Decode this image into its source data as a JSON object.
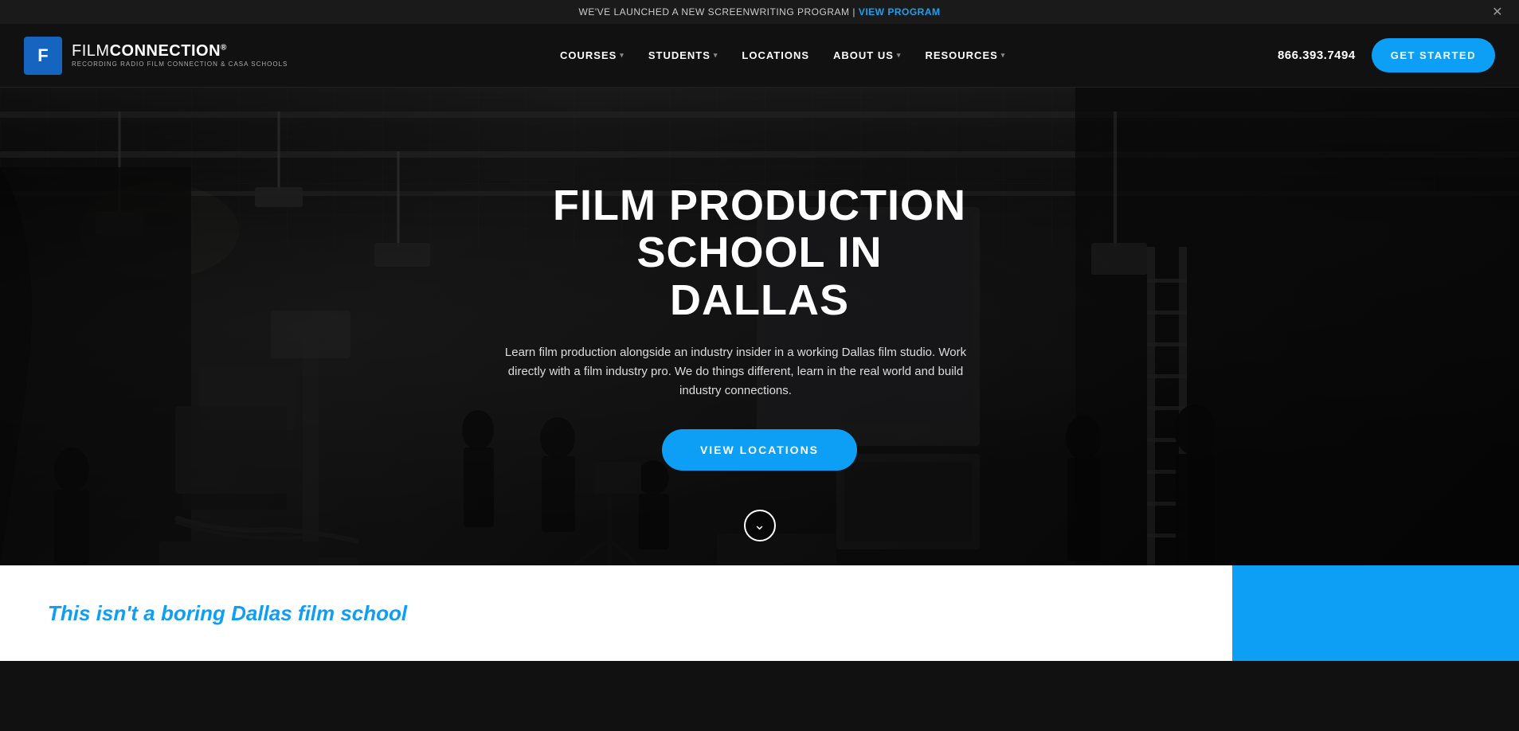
{
  "announcement": {
    "text": "WE'VE LAUNCHED A NEW SCREENWRITING PROGRAM |",
    "link_text": "VIEW PROGRAM",
    "link_href": "#"
  },
  "header": {
    "logo": {
      "icon": "F",
      "name_part1": "FILM",
      "name_part2": "CONNECTION",
      "trademark": "®",
      "subtitle": "RECORDING RADIO FILM CONNECTION & CASA SCHOOLS"
    },
    "nav": [
      {
        "label": "COURSES",
        "has_dropdown": true
      },
      {
        "label": "STUDENTS",
        "has_dropdown": true
      },
      {
        "label": "LOCATIONS",
        "has_dropdown": false
      },
      {
        "label": "ABOUT US",
        "has_dropdown": true
      },
      {
        "label": "RESOURCES",
        "has_dropdown": true
      }
    ],
    "phone": "866.393.7494",
    "cta_label": "GET STARTED"
  },
  "hero": {
    "title_line1": "FILM PRODUCTION SCHOOL IN",
    "title_line2": "DALLAS",
    "description": "Learn film production alongside an industry insider in a working Dallas film studio. Work directly with a film industry pro. We do things different, learn in the real world and build industry connections.",
    "cta_label": "VIEW LOCATIONS"
  },
  "bottom": {
    "tagline": "This isn't a boring Dallas film school"
  }
}
